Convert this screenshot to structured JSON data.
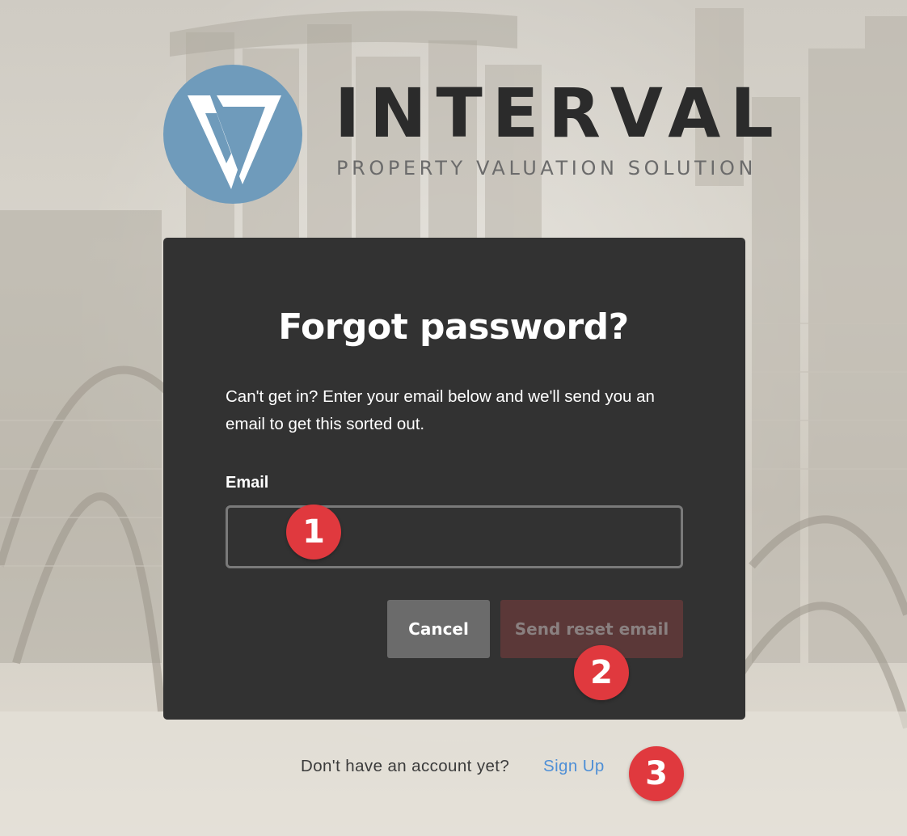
{
  "brand": {
    "name": "INTERVAL",
    "tagline": "PROPERTY VALUATION SOLUTION",
    "logo_color": "#6f9bbb"
  },
  "dialog": {
    "title": "Forgot password?",
    "description": "Can't get in? Enter your email below and we'll send you an email to get this sorted out.",
    "email_label": "Email",
    "email_value": "",
    "email_placeholder": "",
    "cancel_label": "Cancel",
    "send_label": "Send reset email",
    "send_enabled": false
  },
  "footer": {
    "prompt": "Don't have an account yet?",
    "signup_label": "Sign Up"
  },
  "step_markers": [
    "1",
    "2",
    "3"
  ],
  "colors": {
    "card_bg": "#323232",
    "cancel_bg": "#6b6b6b",
    "send_bg_disabled": "#5b3838",
    "link": "#4e8fd6",
    "marker": "#e0393e"
  }
}
